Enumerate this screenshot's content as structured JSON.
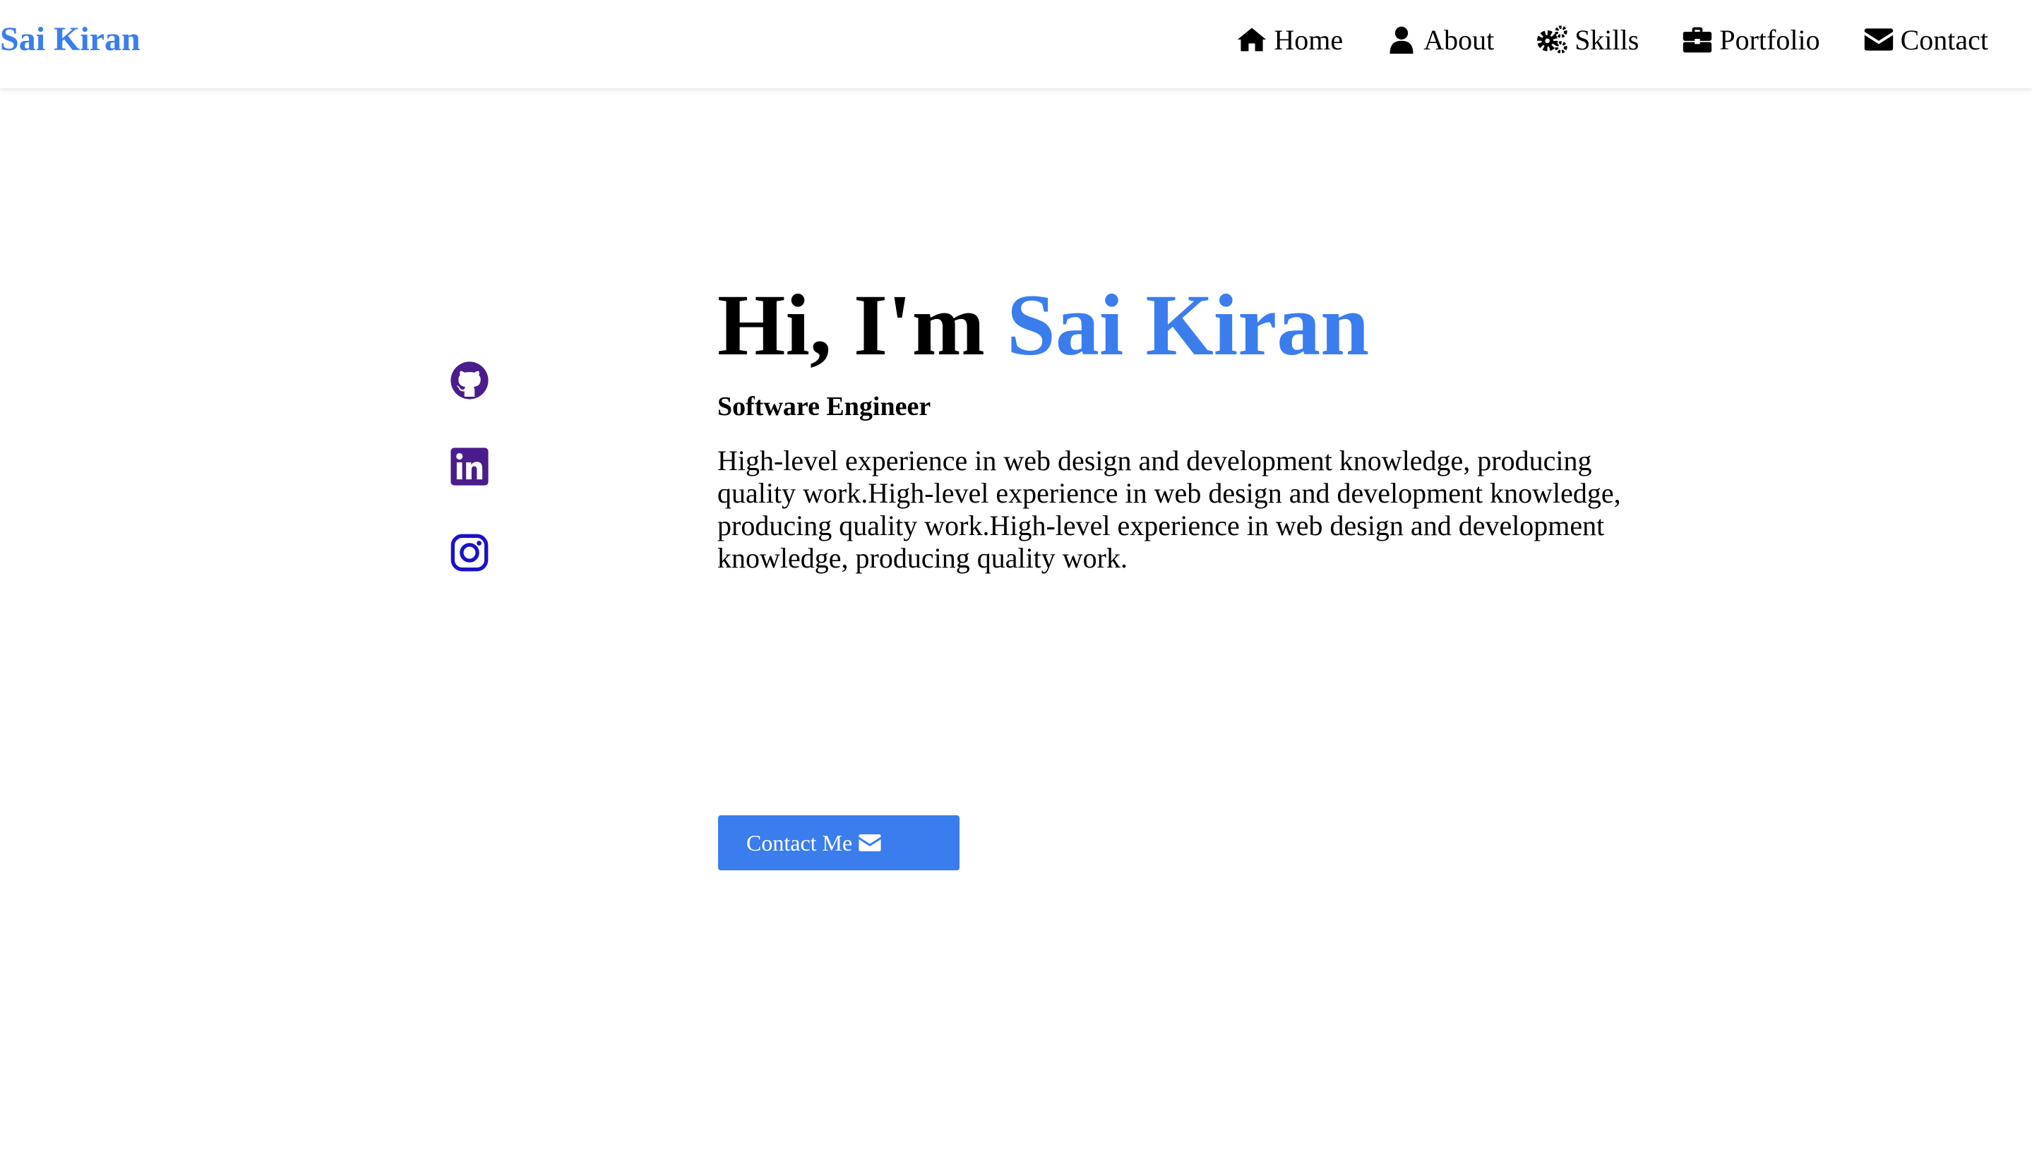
{
  "header": {
    "logo": "Sai Kiran",
    "nav": [
      {
        "label": "Home",
        "icon": "home-icon"
      },
      {
        "label": "About",
        "icon": "user-icon"
      },
      {
        "label": "Skills",
        "icon": "gears-icon"
      },
      {
        "label": "Portfolio",
        "icon": "briefcase-icon"
      },
      {
        "label": "Contact",
        "icon": "envelope-icon"
      }
    ]
  },
  "socials": [
    {
      "icon": "github-icon",
      "color": "#4b1c8c"
    },
    {
      "icon": "linkedin-icon",
      "color": "#4b1c8c"
    },
    {
      "icon": "instagram-icon",
      "color": "#1a12c8"
    }
  ],
  "hero": {
    "greeting": "Hi, I'm ",
    "name": "Sai Kiran",
    "role": "Software Engineer",
    "description": "High-level experience in web design and development knowledge, producing quality work.High-level experience in web design and development knowledge, producing quality work.High-level experience in web design and development knowledge, producing quality work.",
    "button_label": "Contact Me"
  },
  "colors": {
    "accent": "#3b7ded",
    "social_purple": "#4b1c8c",
    "social_blue": "#1a12c8"
  }
}
